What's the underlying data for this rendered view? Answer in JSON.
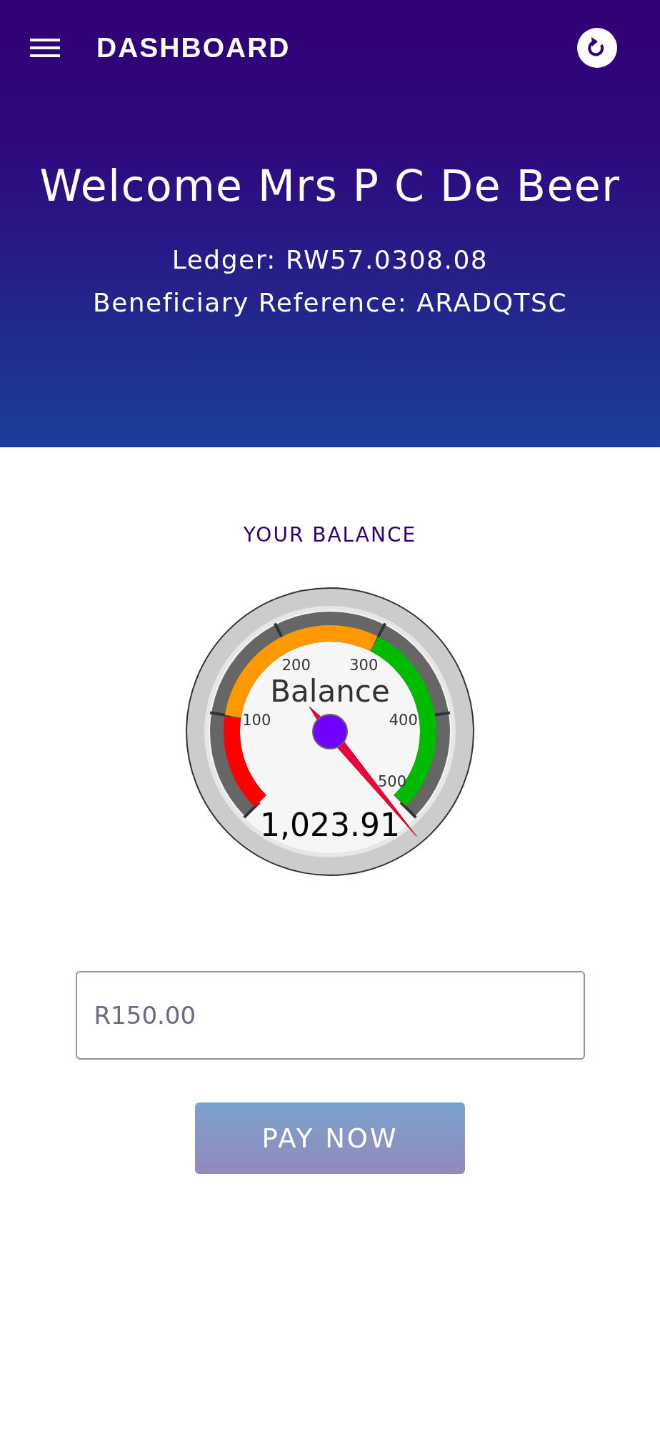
{
  "toolbar": {
    "title": "DASHBOARD"
  },
  "header": {
    "welcome": "Welcome Mrs P C De Beer",
    "ledger": "Ledger: RW57.0308.08",
    "reference": "Beneficiary Reference: ARADQTSC"
  },
  "balance": {
    "heading": "YOUR BALANCE",
    "gauge": {
      "title": "Balance",
      "reading": "1,023.91",
      "ticks": [
        "100",
        "200",
        "300",
        "400",
        "500"
      ],
      "bands": [
        {
          "color": "#ff0000"
        },
        {
          "color": "#ff9900"
        },
        {
          "color": "#00bb00"
        }
      ]
    }
  },
  "payment": {
    "amount": {
      "placeholder": "R150.00"
    },
    "button": "PAY NOW"
  }
}
